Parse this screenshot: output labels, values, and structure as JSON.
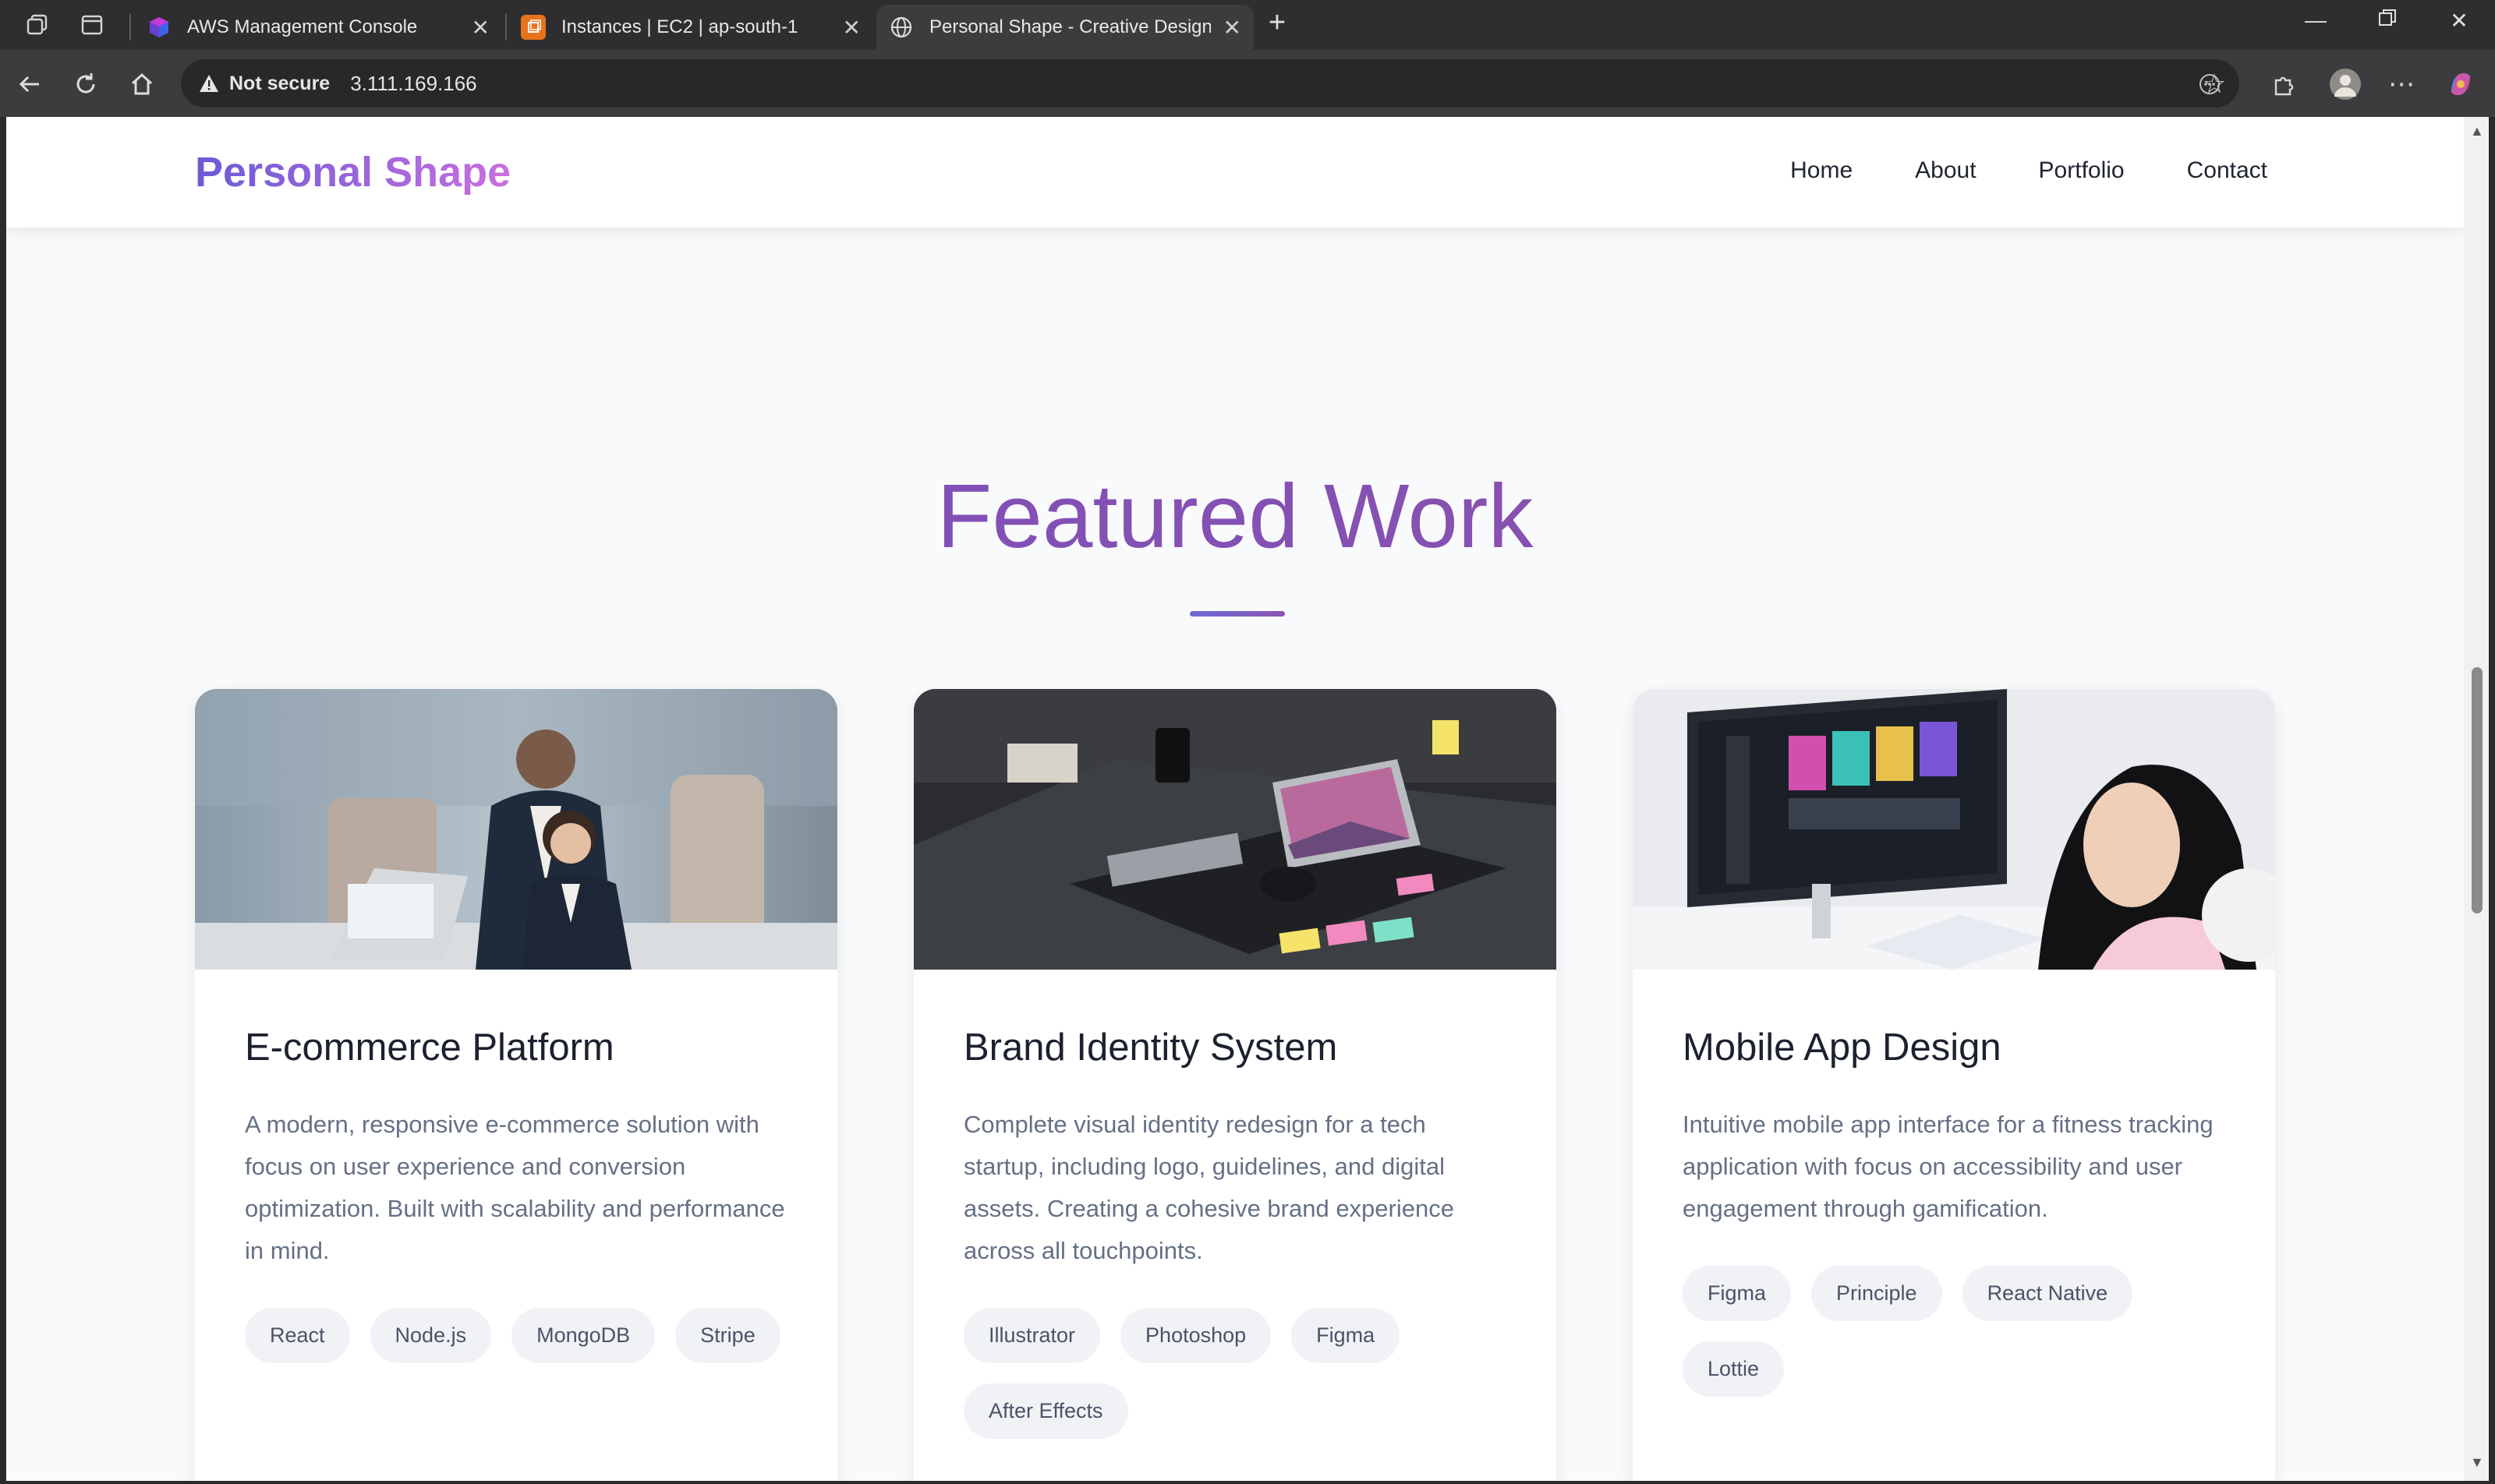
{
  "browser": {
    "tabs": [
      {
        "title": "AWS Management Console",
        "active": false
      },
      {
        "title": "Instances | EC2 | ap-south-1",
        "active": false
      },
      {
        "title": "Personal Shape - Creative Design",
        "active": true
      }
    ],
    "new_tab": "+",
    "security_label": "Not secure",
    "url": "3.111.169.166"
  },
  "site": {
    "logo": "Personal Shape",
    "nav": [
      "Home",
      "About",
      "Portfolio",
      "Contact"
    ]
  },
  "section": {
    "title": "Featured Work"
  },
  "projects": [
    {
      "title": "E-commerce Platform",
      "description": "A modern, responsive e-commerce solution with focus on user experience and conversion optimization. Built with scalability and performance in mind.",
      "tags": [
        "React",
        "Node.js",
        "MongoDB",
        "Stripe"
      ],
      "image": "two-women-office-laptop"
    },
    {
      "title": "Brand Identity System",
      "description": "Complete visual identity redesign for a tech startup, including logo, guidelines, and digital assets. Creating a cohesive brand experience across all touchpoints.",
      "tags": [
        "Illustrator",
        "Photoshop",
        "Figma",
        "After Effects"
      ],
      "image": "dark-desk-laptop-sticky-notes"
    },
    {
      "title": "Mobile App Design",
      "description": "Intuitive mobile app interface for a fitness tracking application with focus on accessibility and user engagement through gamification.",
      "tags": [
        "Figma",
        "Principle",
        "React Native",
        "Lottie"
      ],
      "image": "woman-curved-monitor"
    }
  ],
  "colors": {
    "accent_purple": "#7f4fb8",
    "logo_gradient_start": "#6b5bd6",
    "logo_gradient_end": "#c86fe0",
    "page_bg": "#f9fafb"
  }
}
